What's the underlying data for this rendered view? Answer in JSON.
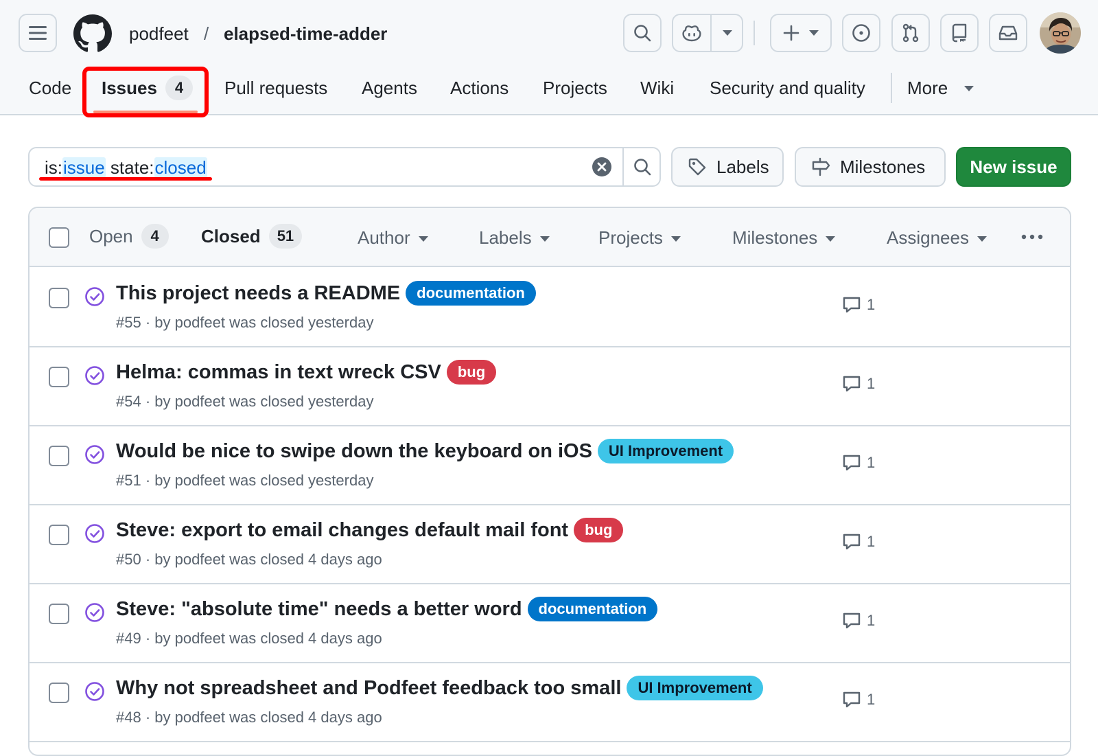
{
  "repo": {
    "owner": "podfeet",
    "separator": "/",
    "name": "elapsed-time-adder"
  },
  "nav": {
    "tabs": [
      {
        "label": "Code"
      },
      {
        "label": "Issues",
        "count": "4"
      },
      {
        "label": "Pull requests"
      },
      {
        "label": "Agents"
      },
      {
        "label": "Actions"
      },
      {
        "label": "Projects"
      },
      {
        "label": "Wiki"
      },
      {
        "label": "Security and quality"
      },
      {
        "label": "More"
      }
    ]
  },
  "search": {
    "prefix1": "is:",
    "value1": "issue",
    "prefix2": " state:",
    "value2": "closed"
  },
  "actions": {
    "labels": "Labels",
    "milestones": "Milestones",
    "new_issue": "New issue"
  },
  "list": {
    "open_label": "Open",
    "open_count": "4",
    "closed_label": "Closed",
    "closed_count": "51",
    "filters": [
      "Author",
      "Labels",
      "Projects",
      "Milestones",
      "Assignees"
    ],
    "issues": [
      {
        "title": "This project needs a README",
        "label": "documentation",
        "meta": "#55 · by podfeet was closed yesterday",
        "comments": "1"
      },
      {
        "title": "Helma: commas in text wreck CSV",
        "label": "bug",
        "meta": "#54 · by podfeet was closed yesterday",
        "comments": "1"
      },
      {
        "title": "Would be nice to swipe down the keyboard on iOS",
        "label": "UI Improvement",
        "meta": "#51 · by podfeet was closed yesterday",
        "comments": "1"
      },
      {
        "title": "Steve: export to email changes default mail font",
        "label": "bug",
        "meta": "#50 · by podfeet was closed 4 days ago",
        "comments": "1"
      },
      {
        "title": "Steve: \"absolute time\" needs a better word",
        "label": "documentation",
        "meta": "#49 · by podfeet was closed 4 days ago",
        "comments": "1"
      },
      {
        "title": "Why not spreadsheet and Podfeet feedback too small",
        "label": "UI Improvement",
        "meta": "#48 · by podfeet was closed 4 days ago",
        "comments": "1"
      }
    ]
  },
  "label_colors": {
    "documentation": {
      "bg": "#0075ca",
      "fg": "#ffffff"
    },
    "bug": {
      "bg": "#d73a4a",
      "fg": "#ffffff"
    },
    "UI Improvement": {
      "bg": "#3ec5e8",
      "fg": "#0b1a2a"
    }
  },
  "colors": {
    "closed_icon": "#8250df",
    "primary_button": "#1f883d",
    "annotation": "#ff0000"
  },
  "icons": {
    "menu": "hamburger-icon",
    "logo": "github-logo-icon",
    "search": "search-icon",
    "copilot": "copilot-icon",
    "create": "plus-icon",
    "issues": "issue-opened-icon",
    "pulls": "git-pull-request-icon",
    "repos": "repo-icon",
    "inbox": "inbox-icon",
    "clear": "x-circle-fill-icon",
    "tag": "tag-icon",
    "milestone": "milestone-icon",
    "closed": "issue-closed-icon",
    "comment": "comment-icon",
    "kebab": "kebab-horizontal-icon"
  }
}
